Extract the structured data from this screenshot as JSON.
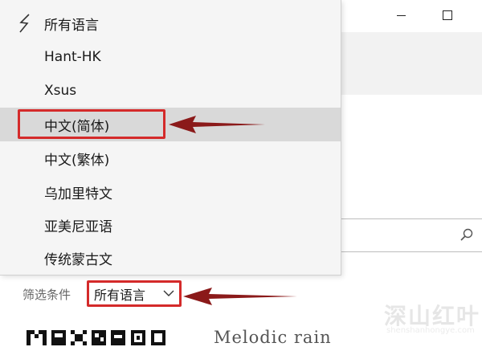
{
  "languages": {
    "items": [
      {
        "label": "所有语言"
      },
      {
        "label": "Hant-HK"
      },
      {
        "label": "Xsus"
      },
      {
        "label": "中文(简体)"
      },
      {
        "label": "中文(繁体)"
      },
      {
        "label": "乌加里特文"
      },
      {
        "label": "亚美尼亚语"
      },
      {
        "label": "传统蒙古文"
      }
    ],
    "checked_index": 0,
    "selected_index": 3
  },
  "filter": {
    "label": "筛选条件",
    "value": "所有语言"
  },
  "previews": {
    "pixel_font_sample": "",
    "script_font_sample": "Melodic rain"
  },
  "watermark": {
    "logo": "深山红叶",
    "url": "shenshanhongye.com"
  },
  "colors": {
    "highlight": "#d42a2a",
    "arrow": "#8b1a1a",
    "menu_bg": "#f5f5f5",
    "selected_bg": "#d9d9d9"
  },
  "icons": {
    "checkmark": "check-icon",
    "minimize": "minimize-icon",
    "maximize": "maximize-icon",
    "search": "search-icon",
    "dropdown": "chevron-down-icon"
  }
}
